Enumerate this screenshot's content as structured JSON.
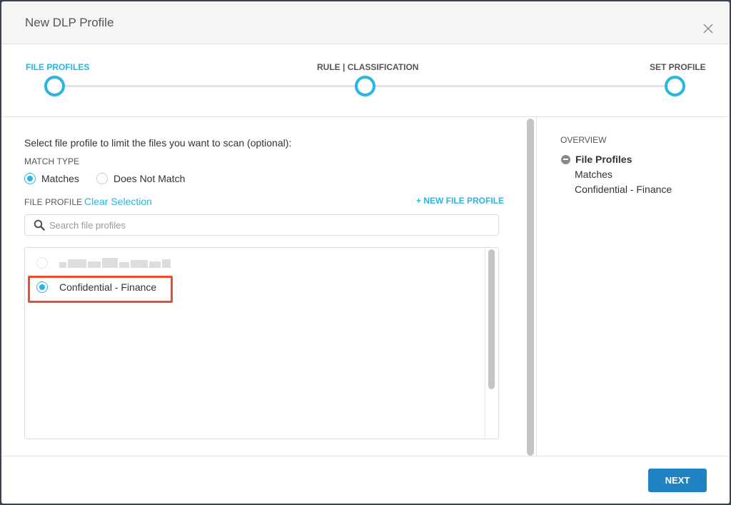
{
  "dialog": {
    "title": "New DLP Profile"
  },
  "stepper": {
    "steps": [
      {
        "label": "FILE PROFILES",
        "active": true
      },
      {
        "label": "RULE | CLASSIFICATION",
        "active": false
      },
      {
        "label": "SET PROFILE",
        "active": false
      }
    ],
    "accent_color": "#29b6e0"
  },
  "main": {
    "intro": "Select file profile to limit the files you want to scan (optional):",
    "match_type": {
      "label": "MATCH TYPE",
      "options": [
        {
          "label": "Matches",
          "selected": true
        },
        {
          "label": "Does Not Match",
          "selected": false
        }
      ]
    },
    "file_profile": {
      "label": "FILE PROFILE",
      "clear_selection": "Clear Selection",
      "new_profile": "+ NEW FILE PROFILE",
      "search_placeholder": "Search file profiles",
      "items": [
        {
          "label": "",
          "selected": false,
          "redacted": true
        },
        {
          "label": "Confidential - Finance",
          "selected": true,
          "redacted": false
        }
      ]
    }
  },
  "overview": {
    "title": "OVERVIEW",
    "section": "File Profiles",
    "lines": [
      "Matches",
      "Confidential - Finance"
    ]
  },
  "footer": {
    "next_label": "NEXT",
    "button_color": "#1f82c2"
  },
  "highlight_color": "#e94f2e"
}
